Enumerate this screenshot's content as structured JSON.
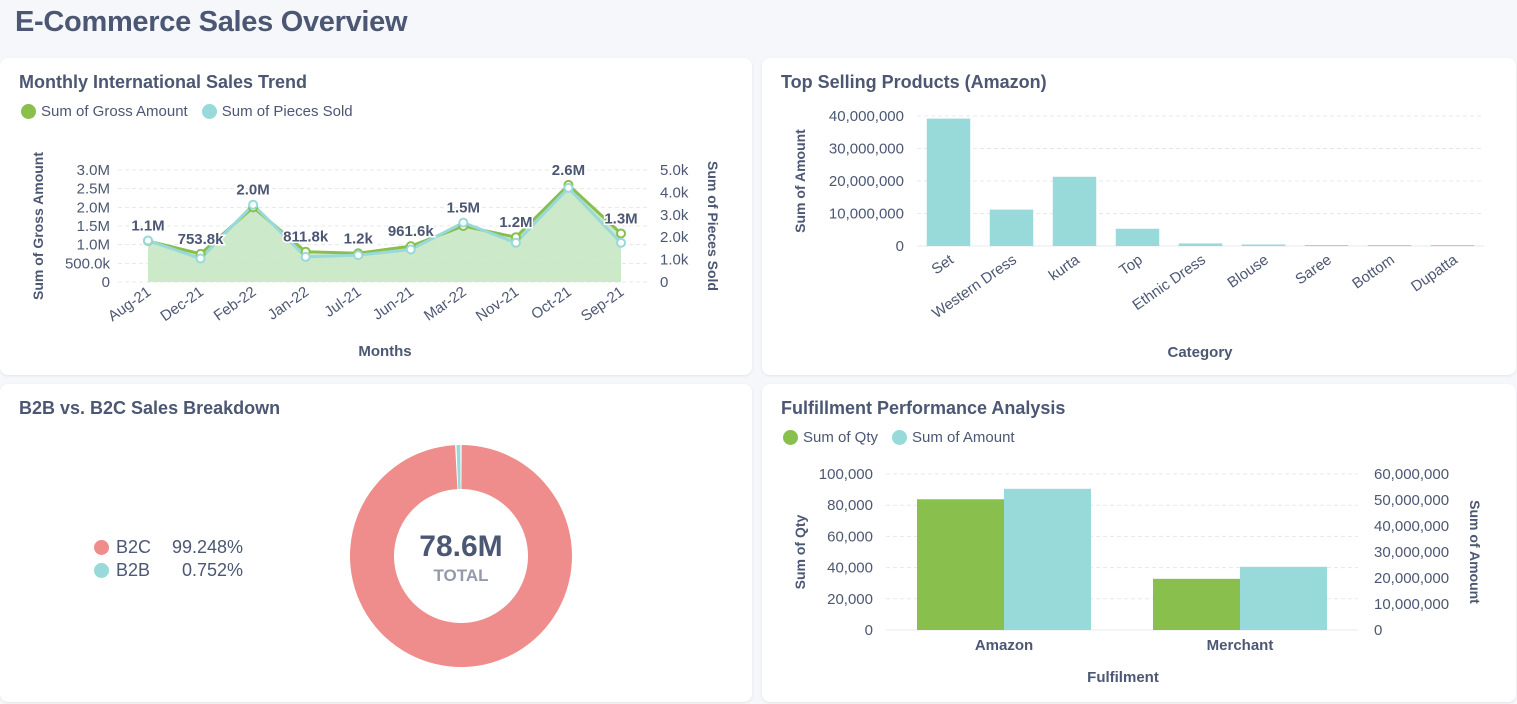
{
  "page": {
    "title": "E-Commerce Sales Overview"
  },
  "colors": {
    "green": "#88bf4d",
    "teal": "#98d9d9",
    "red": "#ef8c8c",
    "grid": "#e6e8ec",
    "text": "#4c5773"
  },
  "cards": {
    "trend": {
      "title": "Monthly International Sales Trend"
    },
    "top": {
      "title": "Top Selling Products (Amazon)"
    },
    "b2b": {
      "title": "B2B vs. B2C Sales Breakdown"
    },
    "fulfil": {
      "title": "Fulfillment Performance Analysis"
    }
  },
  "chart_data": [
    {
      "type": "line",
      "title": "Monthly International Sales Trend",
      "xlabel": "Months",
      "ylabel": "Sum of Gross Amount",
      "ylabel_right": "Sum of Pieces Sold",
      "categories": [
        "Aug-21",
        "Dec-21",
        "Feb-22",
        "Jan-22",
        "Jul-21",
        "Jun-21",
        "Mar-22",
        "Nov-21",
        "Oct-21",
        "Sep-21"
      ],
      "ylim": [
        0,
        3000000
      ],
      "y_ticks": [
        "0",
        "500.0k",
        "1.0M",
        "1.5M",
        "2.0M",
        "2.5M",
        "3.0M"
      ],
      "ylim_right": [
        0,
        5000
      ],
      "y_ticks_right": [
        "0",
        "1.0k",
        "2.0k",
        "3.0k",
        "4.0k",
        "5.0k"
      ],
      "series": [
        {
          "name": "Sum of Gross Amount",
          "axis": "left",
          "color": "#88bf4d",
          "values": [
            1100000,
            753800,
            2000000,
            811800,
            770000,
            961600,
            1500000,
            1200000,
            2600000,
            1300000
          ],
          "labels": [
            "1.1M",
            "753.8k",
            "2.0M",
            "811.8k",
            "",
            "961.6k",
            "1.5M",
            "1.2M",
            "2.6M",
            "1.3M"
          ]
        },
        {
          "name": "Sum of Pieces Sold",
          "axis": "right",
          "color": "#98d9d9",
          "values": [
            1850,
            1050,
            3450,
            1120,
            1200,
            1450,
            2650,
            1750,
            4200,
            1750
          ],
          "labels": [
            "",
            "",
            "",
            "",
            "1.2k",
            "",
            "",
            "",
            "",
            ""
          ]
        }
      ],
      "legend": "top-left",
      "grid": true
    },
    {
      "type": "bar",
      "title": "Top Selling Products (Amazon)",
      "xlabel": "Category",
      "ylabel": "Sum of Amount",
      "categories": [
        "Set",
        "Western Dress",
        "kurta",
        "Top",
        "Ethnic Dress",
        "Blouse",
        "Saree",
        "Bottom",
        "Dupatta"
      ],
      "values": [
        39200000,
        11200000,
        21300000,
        5300000,
        790000,
        460000,
        120000,
        150000,
        900
      ],
      "ylim": [
        0,
        40000000
      ],
      "y_ticks": [
        "0",
        "10,000,000",
        "20,000,000",
        "30,000,000",
        "40,000,000"
      ],
      "color": "#98d9d9",
      "grid": true
    },
    {
      "type": "pie",
      "title": "B2B vs. B2C Sales Breakdown",
      "total": "78.6M",
      "total_label": "TOTAL",
      "slices": [
        {
          "name": "B2C",
          "percent": 99.248,
          "percent_label": "99.248%",
          "color": "#ef8c8c"
        },
        {
          "name": "B2B",
          "percent": 0.752,
          "percent_label": "0.752%",
          "color": "#98d9d9"
        }
      ],
      "legend": "left"
    },
    {
      "type": "bar",
      "title": "Fulfillment Performance Analysis",
      "xlabel": "Fulfilment",
      "ylabel": "Sum of Qty",
      "ylabel_right": "Sum of Amount",
      "categories": [
        "Amazon",
        "Merchant"
      ],
      "ylim": [
        0,
        100000
      ],
      "y_ticks": [
        "0",
        "20,000",
        "40,000",
        "60,000",
        "80,000",
        "100,000"
      ],
      "ylim_right": [
        0,
        60000000
      ],
      "y_ticks_right": [
        "0",
        "10,000,000",
        "20,000,000",
        "30,000,000",
        "40,000,000",
        "50,000,000",
        "60,000,000"
      ],
      "series": [
        {
          "name": "Sum of Qty",
          "axis": "left",
          "color": "#88bf4d",
          "values": [
            83800,
            32800
          ]
        },
        {
          "name": "Sum of Amount",
          "axis": "right",
          "color": "#98d9d9",
          "values": [
            54300000,
            24300000
          ]
        }
      ],
      "legend": "top-left",
      "grid": true
    }
  ]
}
